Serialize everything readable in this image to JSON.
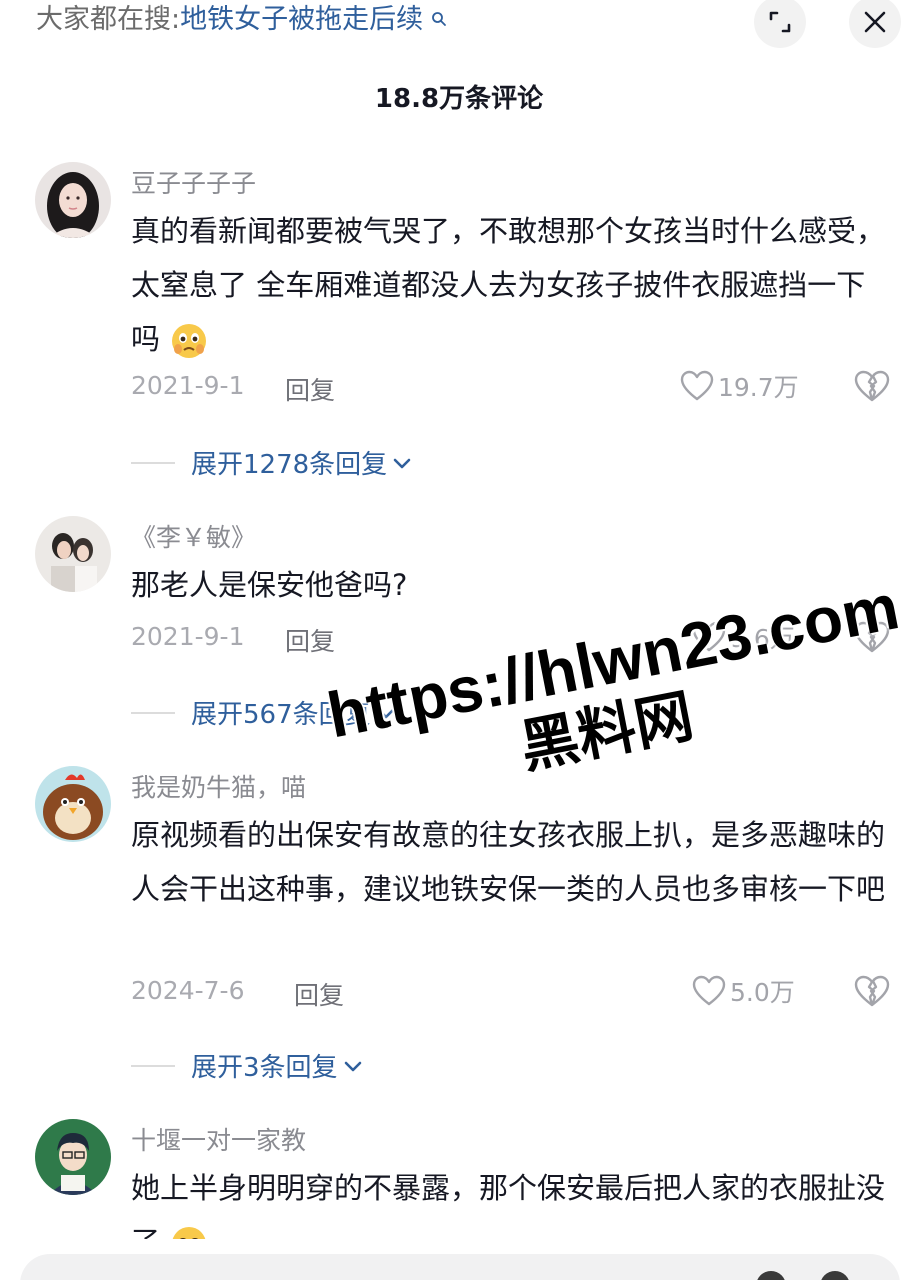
{
  "header": {
    "search_prefix": "大家都在搜:",
    "search_topic": "地铁女子被拖走后续",
    "comment_count": "18.8万条评论"
  },
  "comments": [
    {
      "username": "豆子子子子",
      "text": "真的看新闻都要被气哭了，不敢想那个女孩当时什么感受，太窒息了 全车厢难道都没人去为女孩子披件衣服遮挡一下吗",
      "date": "2021-9-1",
      "reply_label": "回复",
      "likes": "19.7万",
      "expand": "展开1278条回复"
    },
    {
      "username": "《李￥敏》",
      "text": "那老人是保安他爸吗?",
      "date": "2021-9-1",
      "reply_label": "回复",
      "likes": "9.6万",
      "expand": "展开567条回复"
    },
    {
      "username": "我是奶牛猫，喵",
      "text": "原视频看的出保安有故意的往女孩衣服上扒，是多恶趣味的人会干出这种事，建议地铁安保一类的人员也多审核一下吧",
      "date": "2024-7-6",
      "reply_label": "回复",
      "likes": "5.0万",
      "expand": "展开3条回复"
    },
    {
      "username": "十堰一对一家教",
      "text": "她上半身明明穿的不暴露，那个保安最后把人家的衣服扯没了"
    }
  ],
  "watermark": {
    "url": "https://hlwn23.com",
    "site": "黑料网"
  },
  "colors": {
    "link_blue": "#2f5f9c",
    "username_gray": "#8a8b91",
    "meta_gray": "#a9aab0"
  },
  "icons": [
    "collapse-icon",
    "close-icon",
    "heart-icon",
    "broken-heart-icon",
    "chevron-down-icon",
    "search-icon",
    "crying-emoji-icon"
  ]
}
